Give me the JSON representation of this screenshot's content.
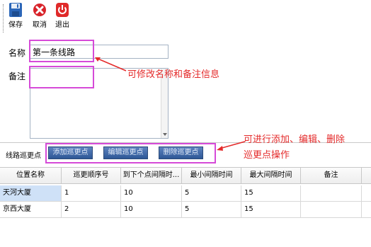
{
  "toolbar": {
    "save_label": "保存",
    "cancel_label": "取消",
    "exit_label": "退出"
  },
  "form": {
    "name_label": "名称",
    "name_value": "第一条线路",
    "remark_label": "备注",
    "remark_value": ""
  },
  "annotations": {
    "edit_note": "可修改名称和备注信息",
    "ops_note_line1": "可进行添加、编辑、删除",
    "ops_note_line2": "巡更点操作",
    "color": "#e42a2a",
    "highlight_color": "#d64ad8"
  },
  "points": {
    "section_label": "线路巡更点",
    "add_label": "添加巡更点",
    "edit_label": "编辑巡更点",
    "delete_label": "删除巡更点"
  },
  "table": {
    "columns": [
      "位置名称",
      "巡更顺序号",
      "到下个点间隔时...",
      "最小间隔时间",
      "最大间隔时间",
      "备注"
    ],
    "rows": [
      [
        "天河大厦",
        "1",
        "10",
        "5",
        "15",
        ""
      ],
      [
        "京西大厦",
        "2",
        "10",
        "5",
        "15",
        ""
      ]
    ]
  }
}
